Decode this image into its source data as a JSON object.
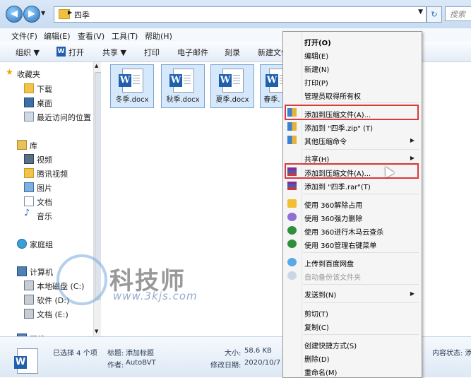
{
  "address": {
    "path": "四季",
    "search_placeholder": "搜索"
  },
  "menubar": [
    {
      "label": "文件(F)"
    },
    {
      "label": "编辑(E)"
    },
    {
      "label": "查看(V)"
    },
    {
      "label": "工具(T)"
    },
    {
      "label": "帮助(H)"
    }
  ],
  "toolbar": [
    {
      "label": "组织 ▼"
    },
    {
      "label": "打开"
    },
    {
      "label": "共享 ▼"
    },
    {
      "label": "打印"
    },
    {
      "label": "电子邮件"
    },
    {
      "label": "刻录"
    },
    {
      "label": "新建文件"
    }
  ],
  "sidebar": [
    {
      "label": "收藏夹",
      "icon": "star-icon"
    },
    {
      "label": "下载",
      "icon": "download-folder-icon"
    },
    {
      "label": "桌面",
      "icon": "desktop-icon"
    },
    {
      "label": "最近访问的位置",
      "icon": "recent-places-icon"
    },
    {
      "label": "库",
      "icon": "library-icon"
    },
    {
      "label": "视频",
      "icon": "video-icon"
    },
    {
      "label": "腾讯视频",
      "icon": "folder-icon"
    },
    {
      "label": "图片",
      "icon": "pictures-icon"
    },
    {
      "label": "文档",
      "icon": "documents-icon"
    },
    {
      "label": "音乐",
      "icon": "music-icon"
    },
    {
      "label": "家庭组",
      "icon": "homegroup-icon"
    },
    {
      "label": "计算机",
      "icon": "computer-icon"
    },
    {
      "label": "本地磁盘 (C:)",
      "icon": "drive-icon"
    },
    {
      "label": "软件 (D:)",
      "icon": "drive-icon"
    },
    {
      "label": "文档 (E:)",
      "icon": "drive-icon"
    },
    {
      "label": "网络",
      "icon": "network-icon"
    }
  ],
  "files": [
    {
      "name": "冬季.docx"
    },
    {
      "name": "秋季.docx"
    },
    {
      "name": "夏季.docx"
    },
    {
      "name": "春季."
    }
  ],
  "watermark": {
    "title": "科技师",
    "url": "www.3kjs.com"
  },
  "status": {
    "selected": "已选择 4 个项",
    "title_label": "标题:",
    "title_value": "添加标题",
    "author_label": "作者:",
    "author_value": "AutoBVT",
    "size_label": "大小:",
    "size_value": "58.6 KB",
    "modified_label": "修改日期:",
    "modified_value": "2020/10/7",
    "content_status": "内容状态: 添"
  },
  "context_menu": [
    {
      "label": "打开(O)",
      "bold": true
    },
    {
      "label": "编辑(E)"
    },
    {
      "label": "新建(N)"
    },
    {
      "label": "打印(P)"
    },
    {
      "label": "管理员取得所有权"
    },
    {
      "label": "添加到压缩文件(A)..."
    },
    {
      "label": "添加到 \"四季.zip\" (T)"
    },
    {
      "label": "其他压缩命令"
    },
    {
      "label": "共享(H)"
    },
    {
      "label": "添加到压缩文件(A)..."
    },
    {
      "label": "添加到 \"四季.rar\"(T)"
    },
    {
      "label": "使用 360解除占用"
    },
    {
      "label": "使用 360强力删除"
    },
    {
      "label": "使用 360进行木马云查杀"
    },
    {
      "label": "使用 360管理右键菜单"
    },
    {
      "label": "上传到百度网盘"
    },
    {
      "label": "自动备份该文件夹",
      "disabled": true
    },
    {
      "label": "发送到(N)"
    },
    {
      "label": "剪切(T)"
    },
    {
      "label": "复制(C)"
    },
    {
      "label": "创建快捷方式(S)"
    },
    {
      "label": "删除(D)"
    },
    {
      "label": "重命名(M)"
    }
  ]
}
